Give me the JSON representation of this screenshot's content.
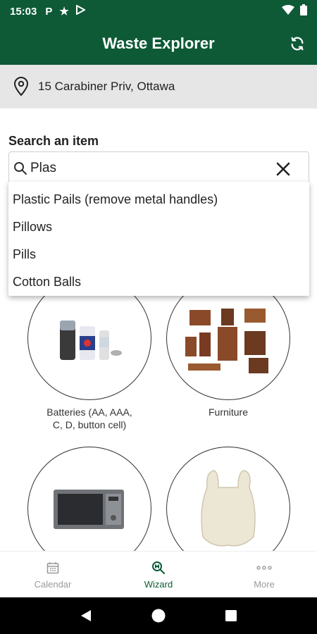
{
  "status_bar": {
    "time": "15:03",
    "icons": [
      "parking-icon",
      "star-icon",
      "play-store-icon",
      "wifi-icon",
      "battery-icon"
    ]
  },
  "app_bar": {
    "title": "Waste Explorer",
    "refresh_icon": "refresh-icon"
  },
  "address": {
    "icon": "location-pin-icon",
    "text": "15 Carabiner Priv, Ottawa"
  },
  "search": {
    "label": "Search an item",
    "value": "Plas",
    "icon": "search-icon",
    "clear_icon": "close-icon"
  },
  "suggestions": [
    "Plastic Pails (remove metal handles)",
    "Pillows",
    "Pills",
    "Cotton Balls"
  ],
  "categories": [
    {
      "label": "Batteries (AA, AAA, C, D, button cell)",
      "image": "batteries-image"
    },
    {
      "label": "Furniture",
      "image": "furniture-image"
    },
    {
      "label": "",
      "image": "microwave-image"
    },
    {
      "label": "",
      "image": "plastic-bag-image"
    }
  ],
  "bottom_nav": [
    {
      "label": "Calendar",
      "icon": "calendar-icon",
      "active": false
    },
    {
      "label": "Wizard",
      "icon": "wizard-search-icon",
      "active": true
    },
    {
      "label": "More",
      "icon": "more-dots-icon",
      "active": false
    }
  ],
  "colors": {
    "primary": "#0e5a36",
    "address_bg": "#e6e6e6",
    "inactive_nav": "#9a9a9a"
  }
}
